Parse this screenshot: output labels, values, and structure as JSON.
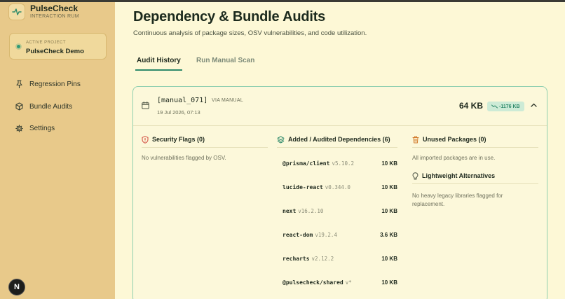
{
  "brand": {
    "name": "PulseCheck",
    "subtitle": "INTERACTION RUM"
  },
  "project": {
    "label": "ACTIVE PROJECT",
    "name": "PulseCheck Demo"
  },
  "nav": {
    "regression": "Regression Pins",
    "bundle": "Bundle Audits",
    "settings": "Settings"
  },
  "badge": "N",
  "page": {
    "title": "Dependency & Bundle Audits",
    "subtitle": "Continuous analysis of package sizes, OSV vulnerabilities, and code utilization."
  },
  "tabs": {
    "history": "Audit History",
    "manual": "Run Manual Scan"
  },
  "audit": {
    "id": "[manual_071]",
    "via": "VIA MANUAL",
    "date": "19 Jul 2026, 07:13",
    "total": "64 KB",
    "delta": "-1176 KB"
  },
  "security": {
    "title": "Security Flags (0)",
    "empty": "No vulnerabilities flagged by OSV."
  },
  "deps": {
    "title": "Added / Audited Dependencies (6)",
    "items": [
      {
        "name": "@prisma/client",
        "version": "v5.10.2",
        "size": "10 KB"
      },
      {
        "name": "lucide-react",
        "version": "v0.344.0",
        "size": "10 KB"
      },
      {
        "name": "next",
        "version": "v16.2.10",
        "size": "10 KB"
      },
      {
        "name": "react-dom",
        "version": "v19.2.4",
        "size": "3.6 KB"
      },
      {
        "name": "recharts",
        "version": "v2.12.2",
        "size": "10 KB"
      },
      {
        "name": "@pulsecheck/shared",
        "version": "v*",
        "size": "10 KB"
      }
    ]
  },
  "unused": {
    "title": "Unused Packages (0)",
    "empty": "All imported packages are in use."
  },
  "alternatives": {
    "title": "Lightweight Alternatives",
    "empty": "No heavy legacy libraries flagged for replacement."
  }
}
